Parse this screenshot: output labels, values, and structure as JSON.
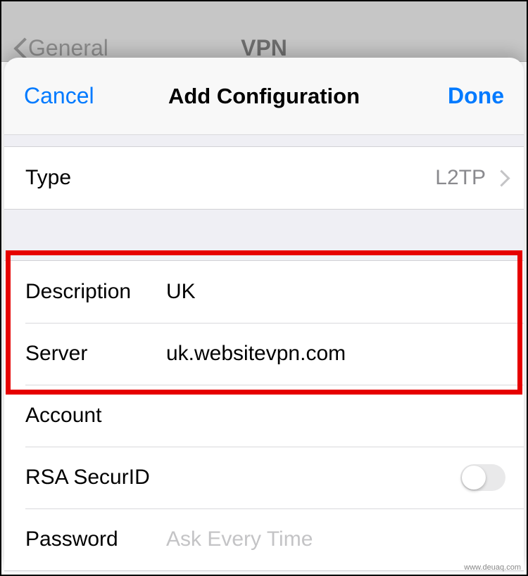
{
  "backdrop": {
    "back_label": "General",
    "title": "VPN"
  },
  "sheet": {
    "cancel": "Cancel",
    "title": "Add Configuration",
    "done": "Done"
  },
  "type_row": {
    "label": "Type",
    "value": "L2TP"
  },
  "fields": {
    "description": {
      "label": "Description",
      "value": "UK"
    },
    "server": {
      "label": "Server",
      "value": "uk.websitevpn.com"
    },
    "account": {
      "label": "Account",
      "value": ""
    },
    "rsa": {
      "label": "RSA SecurID",
      "on": false
    },
    "password": {
      "label": "Password",
      "value": "",
      "placeholder": "Ask Every Time"
    }
  },
  "watermark": "www.deuaq.com"
}
